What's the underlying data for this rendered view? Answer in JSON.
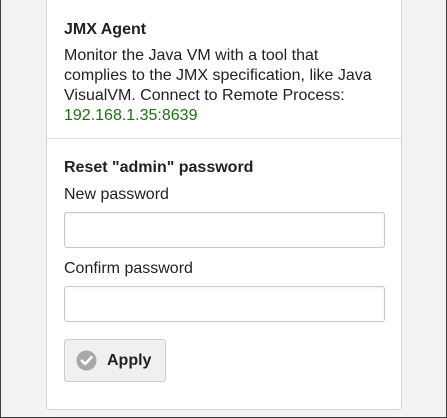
{
  "jmx": {
    "title": "JMX Agent",
    "description": "Monitor the Java VM with a tool that complies to the JMX specification, like Java VisualVM. Connect to Remote Process:",
    "address": "192.168.1.35:8639",
    "address_color": "#1e6e12"
  },
  "reset": {
    "title": "Reset \"admin\" password",
    "new_password_label": "New password",
    "new_password_value": "",
    "confirm_password_label": "Confirm password",
    "confirm_password_value": "",
    "apply_label": "Apply",
    "apply_icon": "check-circle-icon"
  }
}
